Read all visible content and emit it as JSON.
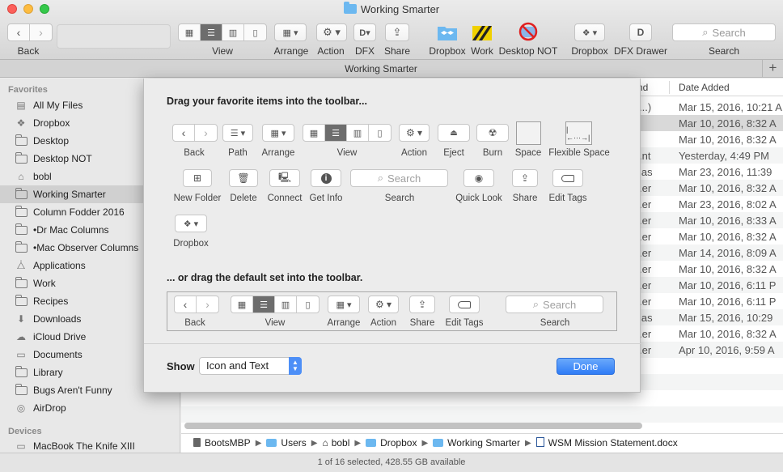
{
  "window": {
    "title": "Working Smarter",
    "tab_title": "Working Smarter",
    "tab_add": "+"
  },
  "toolbar": {
    "back_label": "Back",
    "view_label": "View",
    "arrange_label": "Arrange",
    "action_label": "Action",
    "dfx_label": "DFX",
    "share_label": "Share",
    "dropbox_label": "Dropbox",
    "work_label": "Work",
    "desktop_not_label": "Desktop NOT",
    "dropbox2_label": "Dropbox",
    "dfx_drawer_label": "DFX Drawer",
    "search_label": "Search",
    "search_placeholder": "Search"
  },
  "sidebar": {
    "favorites_header": "Favorites",
    "devices_header": "Devices",
    "items": [
      {
        "label": "All My Files",
        "icon": "all-files-icon"
      },
      {
        "label": "Dropbox",
        "icon": "dropbox-icon"
      },
      {
        "label": "Desktop",
        "icon": "folder-icon"
      },
      {
        "label": "Desktop NOT",
        "icon": "folder-icon"
      },
      {
        "label": "bobl",
        "icon": "home-icon"
      },
      {
        "label": "Working Smarter",
        "icon": "folder-icon"
      },
      {
        "label": "Column Fodder 2016",
        "icon": "folder-icon"
      },
      {
        "label": "•Dr Mac Columns",
        "icon": "folder-icon"
      },
      {
        "label": "•Mac Observer Columns",
        "icon": "folder-icon"
      },
      {
        "label": "Applications",
        "icon": "applications-icon"
      },
      {
        "label": "Work",
        "icon": "folder-icon"
      },
      {
        "label": "Recipes",
        "icon": "folder-icon"
      },
      {
        "label": "Downloads",
        "icon": "downloads-icon"
      },
      {
        "label": "iCloud Drive",
        "icon": "cloud-icon"
      },
      {
        "label": "Documents",
        "icon": "documents-icon"
      },
      {
        "label": "Library",
        "icon": "folder-icon"
      },
      {
        "label": "Bugs Aren't Funny",
        "icon": "folder-icon"
      },
      {
        "label": "AirDrop",
        "icon": "airdrop-icon"
      }
    ],
    "device_items": [
      {
        "label": "MacBook The Knife XIII",
        "icon": "laptop-icon"
      }
    ]
  },
  "file_list": {
    "kind_header": "nd",
    "date_header": "Date Added",
    "rows": [
      {
        "kind": "...)",
        "date": "Mar 15, 2016, 10:21 A"
      },
      {
        "kind": "",
        "date": "Mar 10, 2016, 8:32 A"
      },
      {
        "kind": "",
        "date": "Mar 10, 2016, 8:32 A"
      },
      {
        "kind": ".nt",
        "date": "Yesterday, 4:49 PM"
      },
      {
        "kind": "ias",
        "date": "Mar 23, 2016, 11:39"
      },
      {
        "kind": ".er",
        "date": "Mar 10, 2016, 8:32 A"
      },
      {
        "kind": ".er",
        "date": "Mar 23, 2016, 8:02 A"
      },
      {
        "kind": ".er",
        "date": "Mar 10, 2016, 8:33 A"
      },
      {
        "kind": ".er",
        "date": "Mar 10, 2016, 8:32 A"
      },
      {
        "kind": ".er",
        "date": "Mar 14, 2016, 8:09 A"
      },
      {
        "kind": ".er",
        "date": "Mar 10, 2016, 8:32 A"
      },
      {
        "kind": ".er",
        "date": "Mar 10, 2016, 6:11 P"
      },
      {
        "kind": ".er",
        "date": "Mar 10, 2016, 6:11 P"
      },
      {
        "kind": "ias",
        "date": "Mar 15, 2016, 10:29"
      },
      {
        "kind": ".er",
        "date": "Mar 10, 2016, 8:32 A"
      },
      {
        "kind": ".er",
        "date": "Apr 10, 2016, 9:59 A"
      }
    ]
  },
  "path_bar": [
    "BootsMBP",
    "Users",
    "bobl",
    "Dropbox",
    "Working Smarter",
    "WSM Mission Statement.docx"
  ],
  "status_bar": "1 of 16 selected, 428.55 GB available",
  "customize_sheet": {
    "favorites_heading": "Drag your favorite items into the toolbar...",
    "default_heading": "... or drag the default set into the toolbar.",
    "items": {
      "back": "Back",
      "path": "Path",
      "arrange": "Arrange",
      "view": "View",
      "action": "Action",
      "eject": "Eject",
      "burn": "Burn",
      "space": "Space",
      "flexible_space": "Flexible Space",
      "new_folder": "New Folder",
      "delete": "Delete",
      "connect": "Connect",
      "get_info": "Get Info",
      "search": "Search",
      "search_placeholder": "Search",
      "quick_look": "Quick Look",
      "share": "Share",
      "edit_tags": "Edit Tags",
      "dropbox": "Dropbox"
    },
    "default_set": {
      "back": "Back",
      "view": "View",
      "arrange": "Arrange",
      "action": "Action",
      "share": "Share",
      "edit_tags": "Edit Tags",
      "search": "Search",
      "search_placeholder": "Search"
    },
    "show_label": "Show",
    "show_value": "Icon and Text",
    "done_label": "Done"
  },
  "colors": {
    "accent": "#3b86f7",
    "selection": "#d0d0d0"
  }
}
